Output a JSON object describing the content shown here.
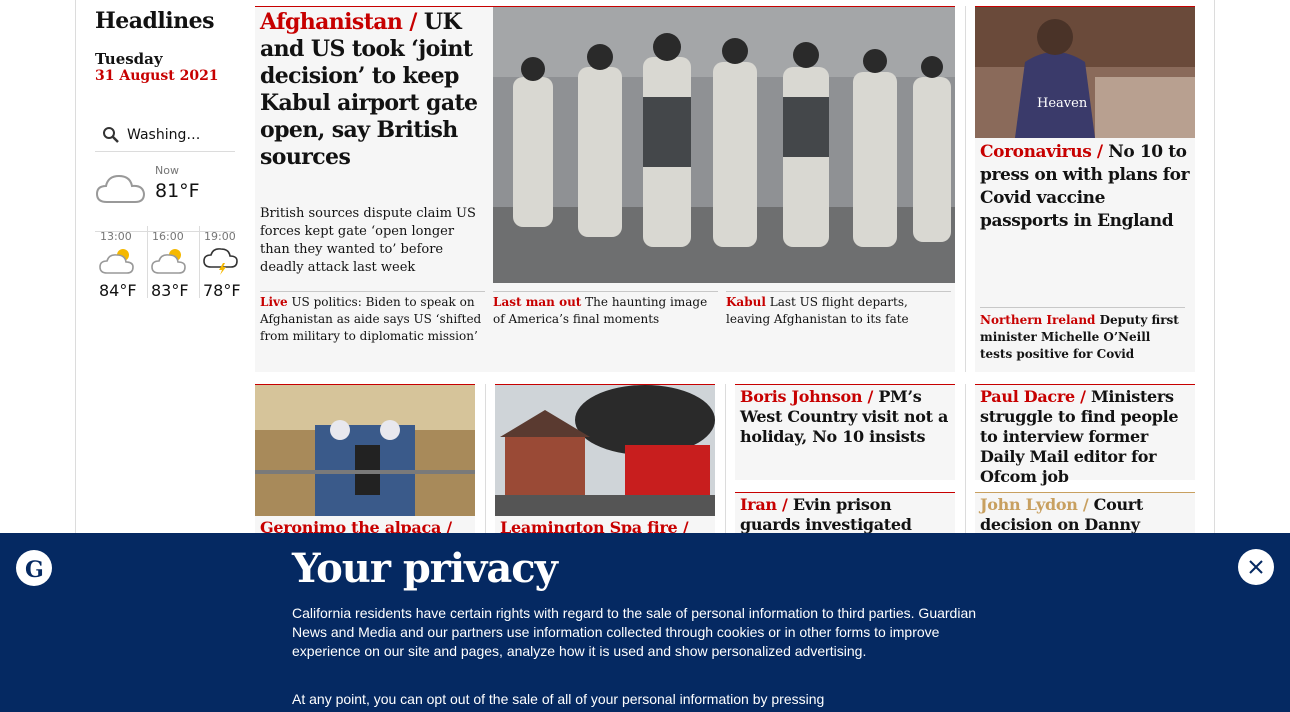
{
  "sidebar": {
    "title": "Headlines",
    "day": "Tuesday",
    "date": "31 August 2021",
    "search_value": "Washing…",
    "weather_now_label": "Now",
    "weather_now_temp": "81°F",
    "forecast": [
      {
        "time": "13:00",
        "temp": "84°F",
        "icon": "partly-cloudy-icon"
      },
      {
        "time": "16:00",
        "temp": "83°F",
        "icon": "partly-cloudy-icon"
      },
      {
        "time": "19:00",
        "temp": "78°F",
        "icon": "thunderstorm-icon"
      }
    ]
  },
  "lead": {
    "kicker": "Afghanistan /",
    "headline": "UK and US took ‘joint decision’ to keep Kabul airport gate open, say British sources",
    "standfirst": "British sources dispute claim US forces kept gate ‘open longer than they wanted to’ before deadly attack last week",
    "subs": [
      {
        "kicker": "Live",
        "text": "US politics: Biden to speak on Afghanistan as aide says US ‘shifted from military to diplomatic mission’"
      },
      {
        "kicker": "Last man out",
        "text": "The haunting image of America’s final moments"
      },
      {
        "kicker": "Kabul",
        "text": "Last US flight departs, leaving Afghanistan to its fate"
      }
    ]
  },
  "covid": {
    "kicker": "Coronavirus /",
    "headline": "No 10 to press on with plans for Covid vaccine passports in England",
    "sub_kicker": "Northern Ireland",
    "sub_text": "Deputy first minister Michelle O’Neill tests positive for Covid"
  },
  "lower": [
    {
      "kicker": "Geronimo the alpaca /",
      "headline": ""
    },
    {
      "kicker": "Leamington Spa fire /",
      "headline": ""
    },
    {
      "kicker": "Boris Johnson /",
      "headline": "PM’s West Country visit not a holiday, No 10 insists"
    },
    {
      "kicker": "Paul Dacre /",
      "headline": "Ministers struggle to find people to interview former Daily Mail editor for Ofcom job"
    },
    {
      "kicker": "Iran /",
      "headline": "Evin prison guards investigated after abuse"
    },
    {
      "kicker": "John Lydon /",
      "headline": "Court decision on Danny Boyle"
    }
  ],
  "privacy": {
    "title": "Your privacy",
    "para1": "California residents have certain rights with regard to the sale of personal information to third parties. Guardian News and Media and our partners use information collected through cookies or in other forms to improve experience on our site and pages, analyze how it is used and show personalized advertising.",
    "para2": "At any point, you can opt out of the sale of all of your personal information by pressing"
  },
  "colors": {
    "accent": "#c70000",
    "banner": "#052962"
  }
}
